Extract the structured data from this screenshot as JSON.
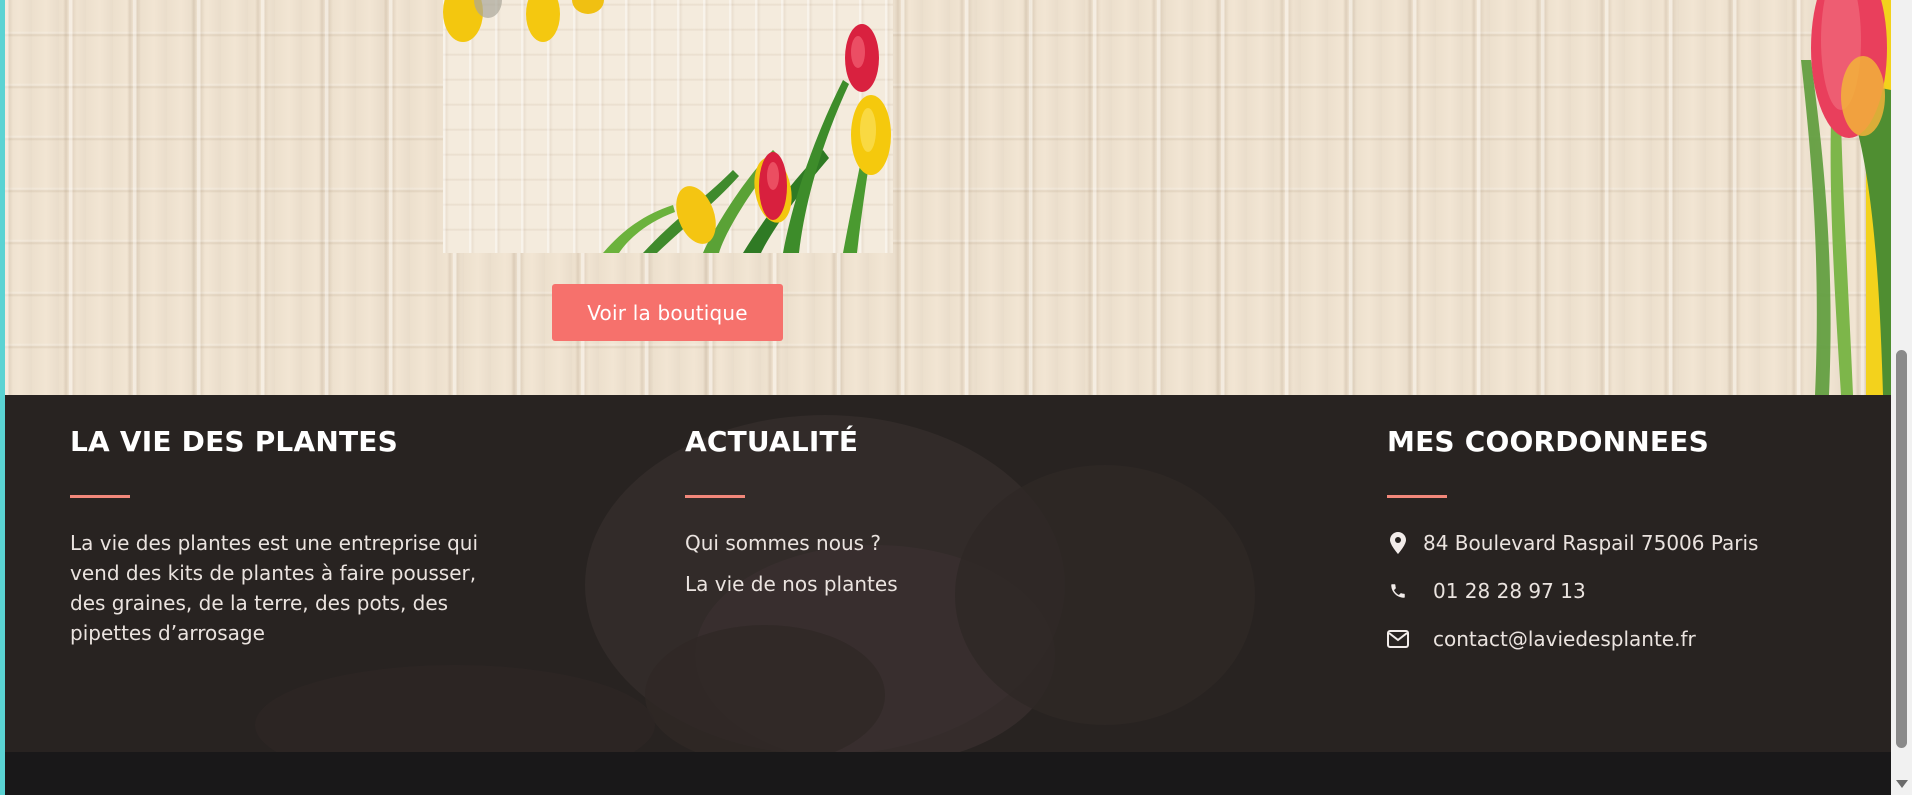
{
  "hero": {
    "button_label": "Voir la boutique"
  },
  "footer": {
    "about": {
      "title": "LA VIE DES PLANTES",
      "text": "La vie des plantes est une entreprise qui vend des kits de plantes à faire pousser, des graines, de la terre, des pots, des pipettes d’arrosage"
    },
    "news": {
      "title": "ACTUALITÉ",
      "links": [
        "Qui sommes nous ?",
        "La vie de nos plantes"
      ]
    },
    "contact": {
      "title": "MES COORDONNEES",
      "items": [
        {
          "icon": "map-pin-icon",
          "text": "84 Boulevard Raspail 75006 Paris"
        },
        {
          "icon": "phone-icon",
          "text": "01 28 28 97 13"
        },
        {
          "icon": "envelope-icon",
          "text": "contact@laviedesplante.fr"
        }
      ]
    }
  },
  "colors": {
    "accent": "#f6716c",
    "footer_bg": "#282321",
    "rule": "#f2877a",
    "left_edge": "#5ad3d3"
  }
}
